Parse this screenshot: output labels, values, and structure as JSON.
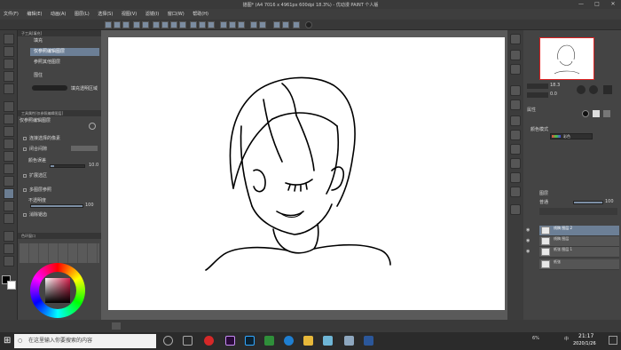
{
  "window": {
    "title": "描图* (A4 7016 x 4961px 600dpi 18.3%) - 优动漫 PAINT 个人版",
    "controls": [
      "—",
      "□",
      "✕"
    ]
  },
  "menu": [
    "文件(F)",
    "编辑(E)",
    "动画(A)",
    "图层(L)",
    "选择(S)",
    "视图(V)",
    "滤镜(I)",
    "窗口(W)",
    "帮助(H)"
  ],
  "subtool": {
    "header": "子工具[填充]",
    "items": [
      {
        "label": "填充"
      },
      {
        "label": "仅参照编辑图层",
        "selected": true
      },
      {
        "label": "参照其他图层"
      },
      {
        "label": "围住"
      },
      {
        "label": "填充透明区域"
      }
    ]
  },
  "tool_property": {
    "header": "工具属性[仅参照编辑图层]",
    "title": "仅参照编辑图层",
    "options": [
      {
        "label": "连接选择的像素",
        "checked": true
      },
      {
        "label": "闭合间隙",
        "checked": true
      },
      {
        "label": "颜色误差",
        "value": "10.0"
      },
      {
        "label": "扩展选区",
        "checked": true
      },
      {
        "label": "多图层参照",
        "checked": true
      },
      {
        "label": "不透明度",
        "value": "100"
      },
      {
        "label": "消除锯齿",
        "checked": true
      }
    ]
  },
  "color_set_header": "色环窗口",
  "navigator": {
    "zoom": "18.3",
    "angle": "0.0"
  },
  "layer_property": {
    "header": "属性",
    "mode_label": "颜色模式",
    "mode_value": "彩色"
  },
  "layers": {
    "header": "图层",
    "blend": "普通",
    "opacity": "100",
    "items": [
      {
        "name": "线稿 图层 2",
        "selected": true
      },
      {
        "name": "线稿 图层"
      },
      {
        "name": "纸张 图层 1"
      },
      {
        "name": "纸张"
      }
    ]
  },
  "taskbar": {
    "search_placeholder": "在这里输入你要搜索的内容",
    "time": "21:17",
    "date": "2020/1/26",
    "battery": "6%",
    "ime": "中"
  },
  "colors": {
    "accent": "#6c7f96",
    "canvas_bg": "#5a5a5a",
    "panel": "#444444"
  }
}
